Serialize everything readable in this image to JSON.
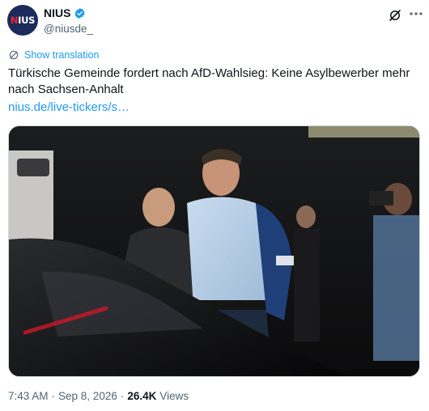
{
  "author": {
    "display_name": "NIUS",
    "handle": "@niusde_",
    "logo_text_red": "N",
    "logo_text_white": "IUS",
    "verified_color": "#1d9bf0"
  },
  "actions": {
    "grok_icon": "grok-icon",
    "more_icon": "more-icon"
  },
  "translation": {
    "label": "Show translation"
  },
  "post": {
    "text": "Türkische Gemeinde fordert nach AfD-Wahlsieg: Keine Asylbewerber mehr nach Sachsen-Anhalt",
    "link": "nius.de/live-tickers/s…"
  },
  "footer": {
    "time": "7:43 AM",
    "date": "Sep 8, 2026",
    "views_count": "26.4K",
    "views_label": "Views",
    "separator": "·"
  },
  "colors": {
    "accent": "#1d9bf0",
    "secondary_text": "#536471",
    "primary_text": "#0f1419",
    "avatar_bg": "#1a2b5c",
    "logo_red": "#e8282d"
  }
}
